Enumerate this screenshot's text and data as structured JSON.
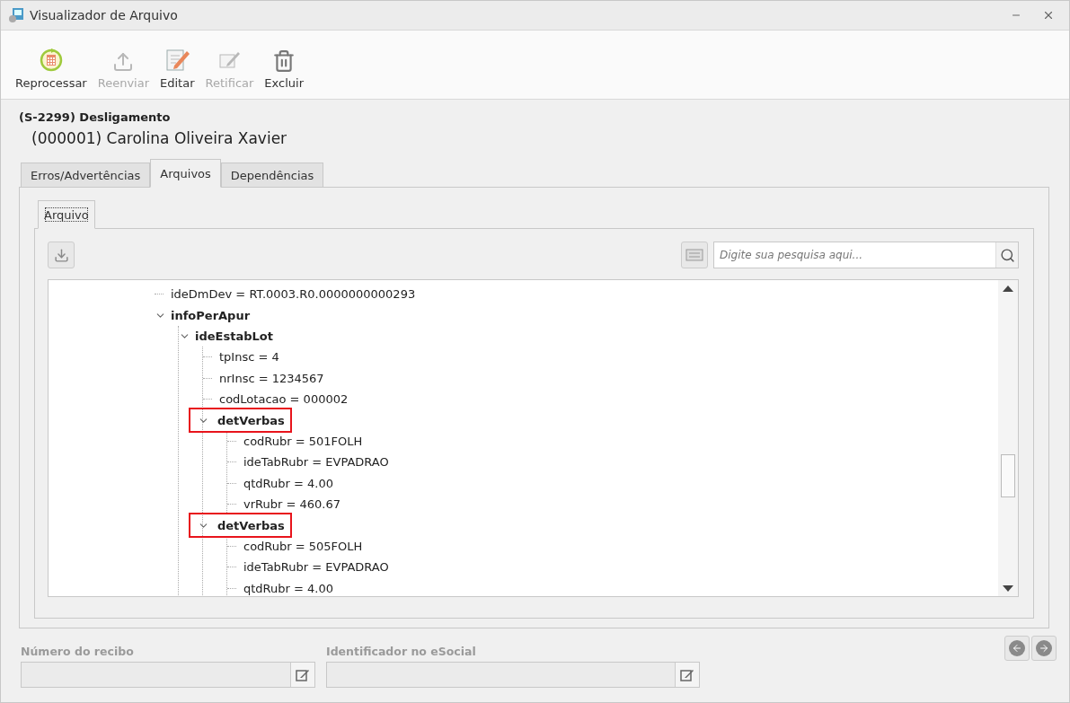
{
  "window": {
    "title": "Visualizador de Arquivo"
  },
  "toolbar": [
    {
      "kind": "reprocess",
      "label": "Reprocessar",
      "disabled": false
    },
    {
      "kind": "upload",
      "label": "Reenviar",
      "disabled": true
    },
    {
      "kind": "edit",
      "label": "Editar",
      "disabled": false
    },
    {
      "kind": "rectify",
      "label": "Retificar",
      "disabled": true
    },
    {
      "kind": "delete",
      "label": "Excluir",
      "disabled": false
    }
  ],
  "header": {
    "event": "(S-2299) Desligamento",
    "employee": "(000001) Carolina Oliveira Xavier"
  },
  "tabs": [
    {
      "label": "Erros/Advertências",
      "selected": false
    },
    {
      "label": "Arquivos",
      "selected": true
    },
    {
      "label": "Dependências",
      "selected": false
    }
  ],
  "inner_tabs": [
    {
      "label": "Arquivo",
      "selected": true
    }
  ],
  "search": {
    "placeholder": "Digite sua pesquisa aqui..."
  },
  "tree": [
    {
      "kind": "field",
      "label": "ideDmDev = RT.0003.R0.0000000000293"
    },
    {
      "kind": "group",
      "label": "infoPerApur",
      "expanded": true,
      "highlighted": false,
      "children": [
        {
          "kind": "group",
          "label": "ideEstabLot",
          "expanded": true,
          "highlighted": false,
          "children": [
            {
              "kind": "field",
              "label": "tpInsc = 4"
            },
            {
              "kind": "field",
              "label": "nrInsc = 1234567"
            },
            {
              "kind": "field",
              "label": "codLotacao = 000002"
            },
            {
              "kind": "group",
              "label": "detVerbas",
              "expanded": true,
              "highlighted": true,
              "children": [
                {
                  "kind": "field",
                  "label": "codRubr = 501FOLH"
                },
                {
                  "kind": "field",
                  "label": "ideTabRubr = EVPADRAO"
                },
                {
                  "kind": "field",
                  "label": "qtdRubr = 4.00"
                },
                {
                  "kind": "field",
                  "label": "vrRubr = 460.67"
                }
              ]
            },
            {
              "kind": "group",
              "label": "detVerbas",
              "expanded": true,
              "highlighted": true,
              "children": [
                {
                  "kind": "field",
                  "label": "codRubr = 505FOLH"
                },
                {
                  "kind": "field",
                  "label": "ideTabRubr = EVPADRAO"
                },
                {
                  "kind": "field",
                  "label": "qtdRubr = 4.00"
                }
              ]
            }
          ]
        }
      ]
    }
  ],
  "fields": [
    {
      "label": "Número do recibo",
      "disabled": true
    },
    {
      "label": "Identificador no eSocial",
      "disabled": true
    }
  ]
}
